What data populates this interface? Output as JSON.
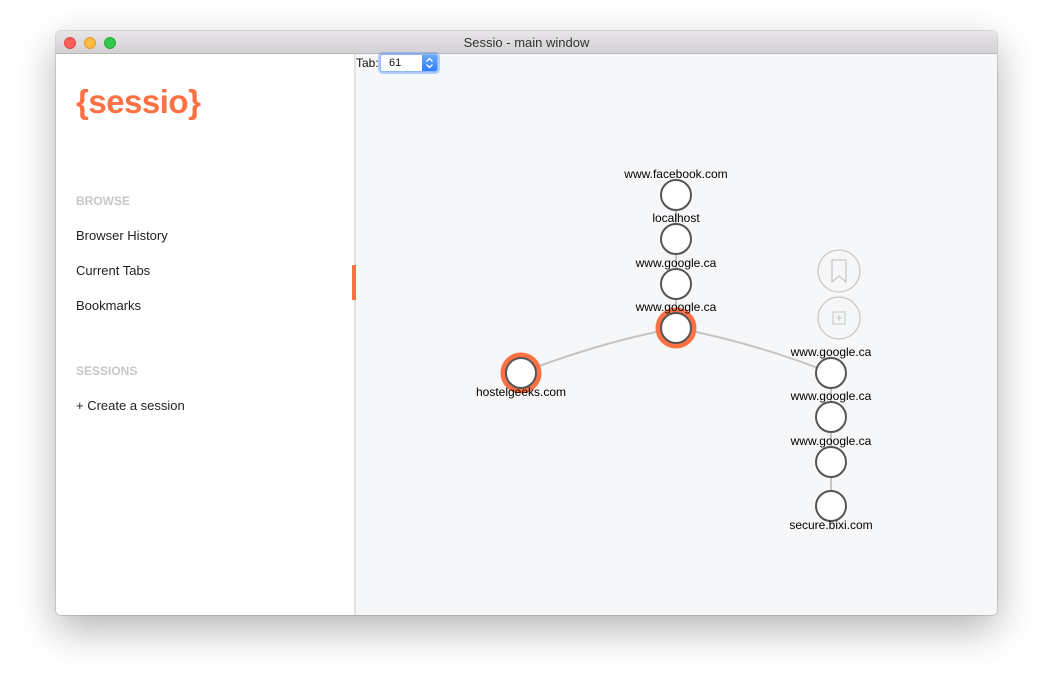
{
  "window": {
    "title": "Sessio - main window"
  },
  "sidebar": {
    "logo": "{sessio}",
    "browse_title": "BROWSE",
    "browse_items": [
      {
        "label": "Browser History"
      },
      {
        "label": "Current Tabs"
      },
      {
        "label": "Bookmarks",
        "active": true
      }
    ],
    "sessions_title": "SESSIONS",
    "create_session_label": "+ Create a session"
  },
  "content": {
    "tab_label": "Tab:",
    "tab_value": "61",
    "graph_nodes": [
      {
        "label": "www.facebook.com",
        "highlighted": false
      },
      {
        "label": "localhost",
        "highlighted": false
      },
      {
        "label": "www.google.ca",
        "highlighted": false
      },
      {
        "label": "www.google.ca",
        "highlighted": true
      },
      {
        "label": "hostelgeeks.com",
        "highlighted": true
      },
      {
        "label": "www.google.ca",
        "highlighted": false
      },
      {
        "label": "www.google.ca",
        "highlighted": false
      },
      {
        "label": "www.google.ca",
        "highlighted": false
      },
      {
        "label": "secure.bixi.com",
        "highlighted": false
      }
    ]
  },
  "colors": {
    "accent": "#ff7043",
    "node_stroke": "#555555",
    "edge": "#c4c4c4",
    "action_icon": "#c8c8c8"
  }
}
